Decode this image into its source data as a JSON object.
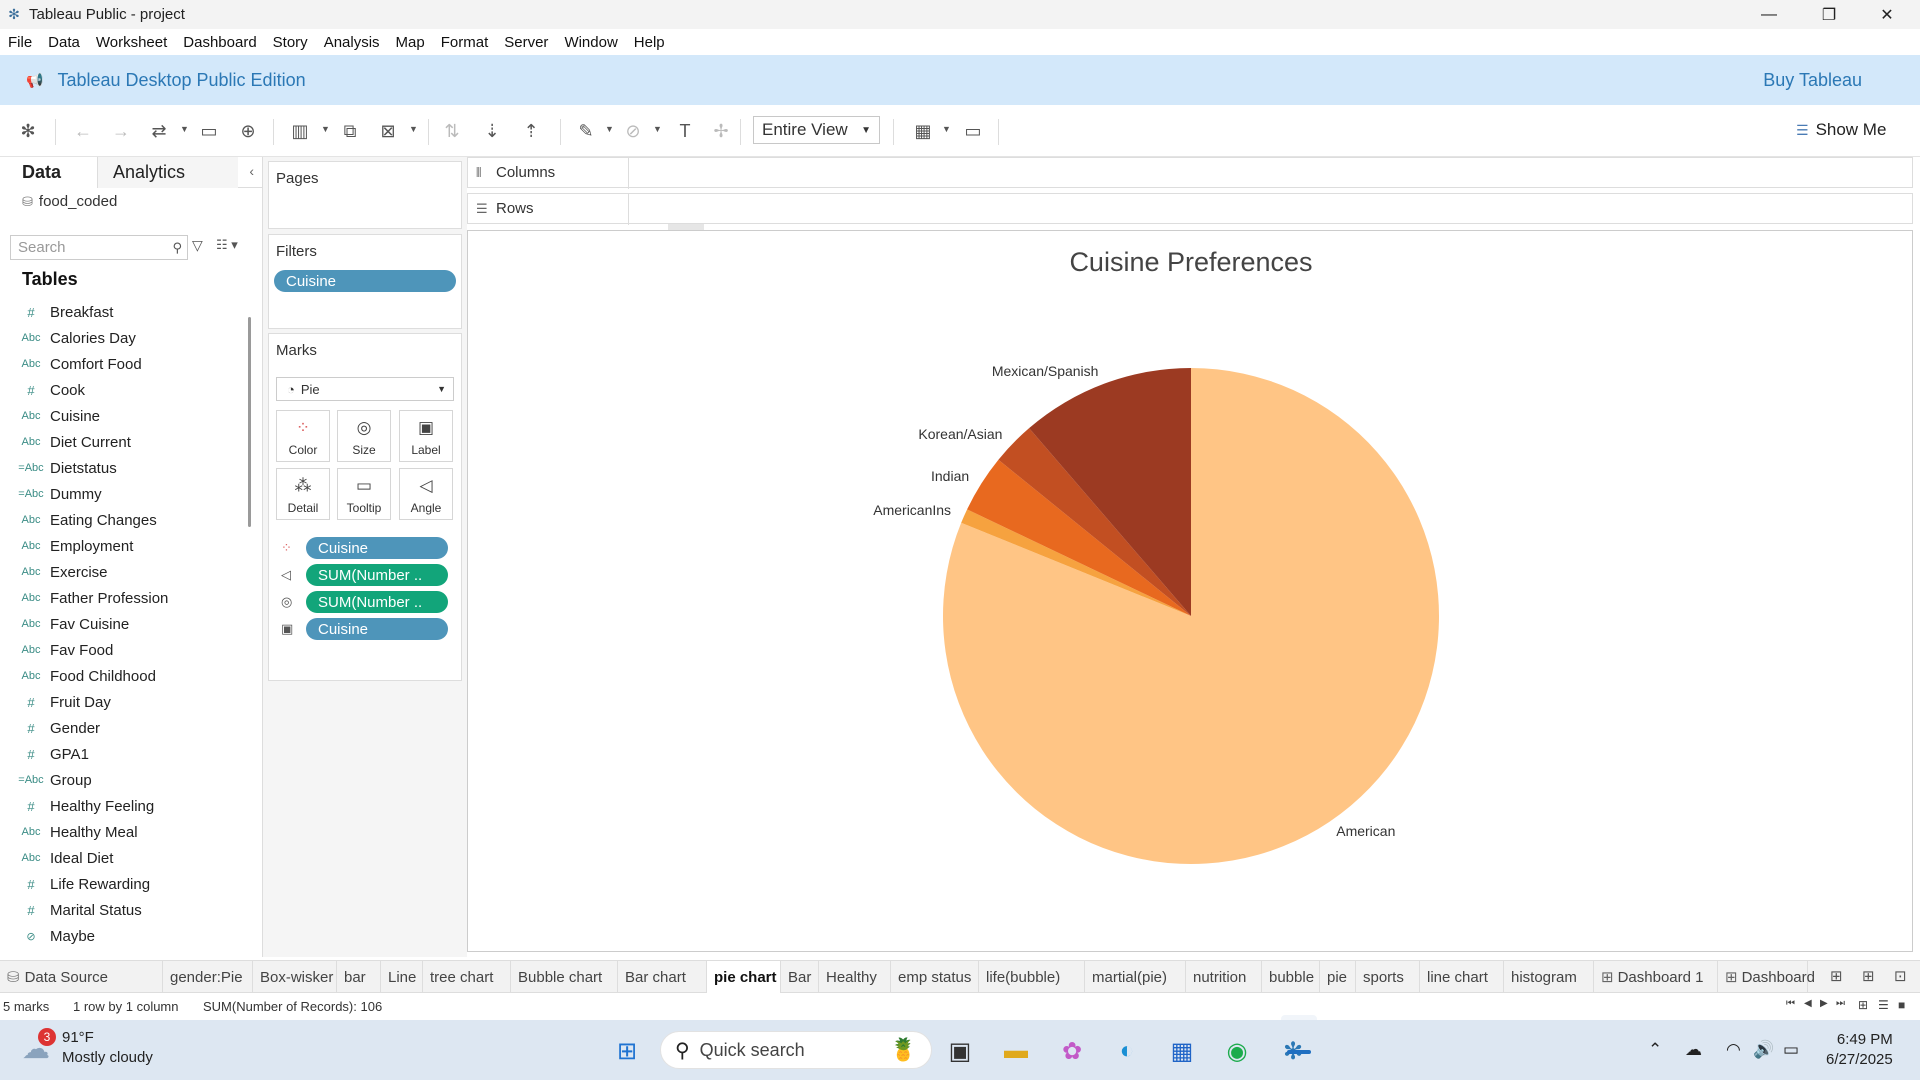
{
  "window": {
    "title": "Tableau Public - project",
    "controls": [
      "—",
      "❐",
      "✕"
    ]
  },
  "menu": [
    "File",
    "Data",
    "Worksheet",
    "Dashboard",
    "Story",
    "Analysis",
    "Map",
    "Format",
    "Server",
    "Window",
    "Help"
  ],
  "banner": {
    "title": "Tableau Desktop Public Edition",
    "buy": "Buy Tableau"
  },
  "toolbar": {
    "fit_select": "Entire View",
    "show_me": "Show Me"
  },
  "data_pane": {
    "tab_data": "Data",
    "tab_analytics": "Analytics",
    "datasource": "food_coded",
    "search_placeholder": "Search",
    "tables_heading": "Tables",
    "fields": [
      {
        "type": "#",
        "name": "Breakfast"
      },
      {
        "type": "Abc",
        "name": "Calories Day"
      },
      {
        "type": "Abc",
        "name": "Comfort Food"
      },
      {
        "type": "#",
        "name": "Cook"
      },
      {
        "type": "Abc",
        "name": "Cuisine"
      },
      {
        "type": "Abc",
        "name": "Diet Current"
      },
      {
        "type": "=Abc",
        "name": "Dietstatus"
      },
      {
        "type": "=Abc",
        "name": "Dummy"
      },
      {
        "type": "Abc",
        "name": "Eating Changes"
      },
      {
        "type": "Abc",
        "name": "Employment"
      },
      {
        "type": "Abc",
        "name": "Exercise"
      },
      {
        "type": "Abc",
        "name": "Father Profession"
      },
      {
        "type": "Abc",
        "name": "Fav Cuisine"
      },
      {
        "type": "Abc",
        "name": "Fav Food"
      },
      {
        "type": "Abc",
        "name": "Food Childhood"
      },
      {
        "type": "#",
        "name": "Fruit Day"
      },
      {
        "type": "#",
        "name": "Gender"
      },
      {
        "type": "#",
        "name": "GPA1"
      },
      {
        "type": "=Abc",
        "name": "Group"
      },
      {
        "type": "#",
        "name": "Healthy Feeling"
      },
      {
        "type": "Abc",
        "name": "Healthy Meal"
      },
      {
        "type": "Abc",
        "name": "Ideal Diet"
      },
      {
        "type": "#",
        "name": "Life Rewarding"
      },
      {
        "type": "#",
        "name": "Marital Status"
      },
      {
        "type": "⊘",
        "name": "Maybe"
      }
    ]
  },
  "shelves": {
    "pages": "Pages",
    "filters": "Filters",
    "filter_pills": [
      "Cuisine"
    ],
    "marks": "Marks",
    "mark_type": "Pie",
    "mark_buttons": [
      "Color",
      "Size",
      "Label",
      "Detail",
      "Tooltip",
      "Angle"
    ],
    "mark_pills": [
      {
        "icon": "color",
        "label": "Cuisine",
        "kind": "dimension"
      },
      {
        "icon": "angle",
        "label": "SUM(Number ..",
        "kind": "measure"
      },
      {
        "icon": "size",
        "label": "SUM(Number ..",
        "kind": "measure"
      },
      {
        "icon": "label",
        "label": "Cuisine",
        "kind": "dimension"
      }
    ],
    "columns": "Columns",
    "rows": "Rows"
  },
  "chart_data": {
    "type": "pie",
    "title": "Cuisine Preferences",
    "categories": [
      "American",
      "AmericanIns",
      "Indian",
      "Korean/Asian",
      "Mexican/Spanish"
    ],
    "values": [
      86,
      1,
      4,
      3,
      12
    ],
    "colors": [
      "#ffc585",
      "#f6a23f",
      "#e8691f",
      "#c24f22",
      "#9c3a22"
    ],
    "total": 106
  },
  "sheet_tabs": {
    "data_source": "Data Source",
    "tabs": [
      "gender:Pie",
      "Box-wisker",
      "bar",
      "Line",
      "tree chart",
      "Bubble chart",
      "Bar chart",
      "pie chart",
      "Bar",
      "Healthy",
      "emp status",
      "life(bubble)",
      "martial(pie)",
      "nutrition",
      "bubble",
      "pie",
      "sports",
      "line chart",
      "histogram",
      "Dashboard 1",
      "Dashboard"
    ],
    "active": "pie chart"
  },
  "status": {
    "marks": "5 marks",
    "rows_cols": "1 row by 1 column",
    "sum": "SUM(Number of Records): 106"
  },
  "taskbar": {
    "weather_temp": "91°F",
    "weather_desc": "Mostly cloudy",
    "weather_badge": "3",
    "search": "Quick search",
    "time": "6:49 PM",
    "date": "6/27/2025"
  }
}
